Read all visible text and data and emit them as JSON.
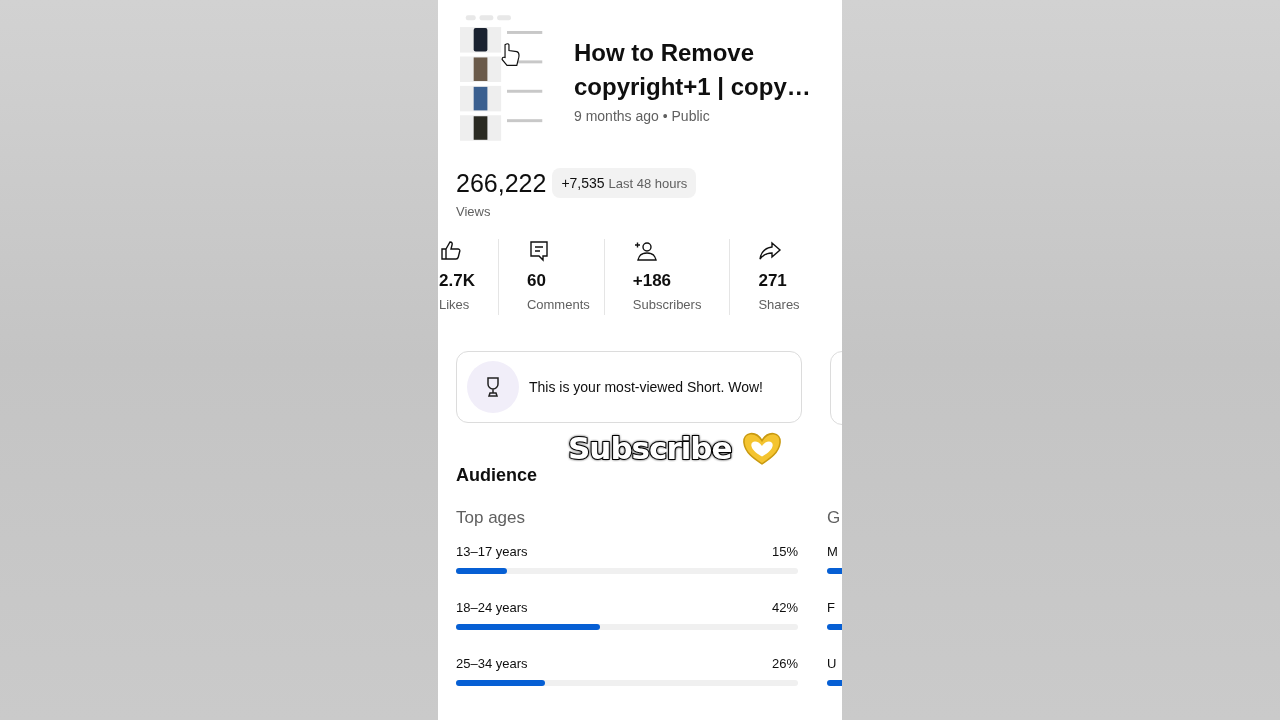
{
  "video": {
    "thumbnail": {
      "kind": "picture"
    },
    "title_lines": [
      "How to Remove",
      "copyright+1 | copy…"
    ],
    "meta": "9 months ago • Public"
  },
  "views": {
    "count": "266,222",
    "delta": "+7,535",
    "period": "Last 48 hours",
    "label": "Views"
  },
  "stats": [
    {
      "kind": "likes",
      "value": "2.7K",
      "label": "Likes"
    },
    {
      "kind": "comments",
      "value": "60",
      "label": "Comments"
    },
    {
      "kind": "subscribers",
      "value": "+186",
      "label": "Subscribers"
    },
    {
      "kind": "shares",
      "value": "271",
      "label": "Shares"
    }
  ],
  "highlight": {
    "text": "This is your most-viewed Short. Wow!"
  },
  "overlay": {
    "text": "Subscribe"
  },
  "audience": {
    "title": "Audience",
    "top_ages": {
      "title": "Top ages",
      "rows": [
        {
          "label": "13–17 years",
          "value": "15%",
          "level": 0.15
        },
        {
          "label": "18–24 years",
          "value": "42%",
          "level": 0.42
        },
        {
          "label": "25–34 years",
          "value": "26%",
          "level": 0.26
        }
      ]
    },
    "next_column": {
      "title": "G",
      "rows": [
        "M",
        "F",
        "U"
      ]
    }
  }
}
